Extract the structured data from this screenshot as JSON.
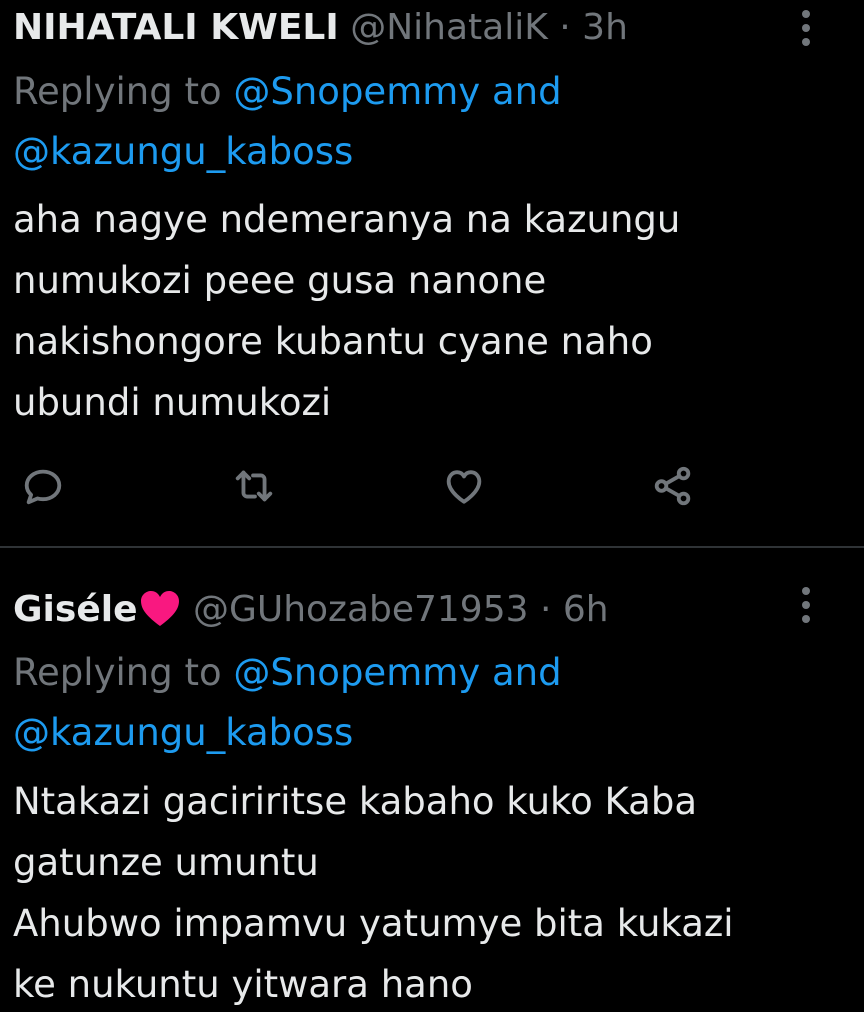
{
  "tweets": [
    {
      "display_name": "NIHATALI KWELI",
      "handle": "@NihataliK",
      "separator": "·",
      "time": "3h",
      "replying_label": "Replying to",
      "replying_user_1": "@Snopemmy",
      "replying_and": "and",
      "replying_user_2": "@kazungu_kaboss",
      "text": "aha nagye ndemeranya na kazungu\nnumukozi peee gusa nanone\nnakishongore kubantu cyane naho\nubundi numukozi",
      "actions": [
        "reply-icon",
        "retweet-icon",
        "like-icon",
        "share-icon"
      ]
    },
    {
      "display_name": "Giséle",
      "name_emoji": "heart-emoji-icon",
      "handle": "@GUhozabe71953",
      "separator": "·",
      "time": "6h",
      "replying_label": "Replying to",
      "replying_user_1": "@Snopemmy",
      "replying_and": "and",
      "replying_user_2": "@kazungu_kaboss",
      "text": "Ntakazi gaciriritse kabaho kuko Kaba\ngatunze umuntu\nAhubwo impamvu yatumye bita kukazi\nke nukuntu yitwara hano"
    }
  ],
  "colors": {
    "background": "#000000",
    "text": "#e7e9ea",
    "secondary": "#71767b",
    "link": "#1d9bf0",
    "heart": "#f91880",
    "divider": "#2f3336"
  }
}
